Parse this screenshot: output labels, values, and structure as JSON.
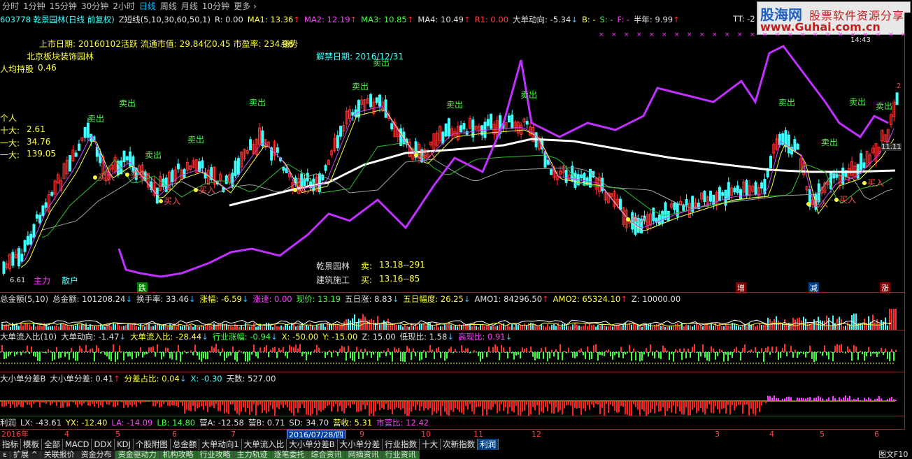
{
  "period_bar": [
    "分时",
    "1分钟",
    "15分钟",
    "30分钟",
    "2小时",
    "日线",
    "周线",
    "月线",
    "10分钟",
    "更多 ›"
  ],
  "period_active": "日线",
  "main_title": {
    "code_name": "603778 乾景园林(日线 前复权)",
    "formula": "Z短线(5,10,30,60,50,1)",
    "r": "R: 0.00",
    "ma1": "MA1: 13.36",
    "ma2": "MA2: 12.19",
    "ma3": "MA3: 10.85",
    "ma4": "MA4: 10.49",
    "r1": "R1: 0.00",
    "big_dir": "大单动向: -5.34",
    "b": "B: -",
    "s": "S: -",
    "f": "F: -",
    "half_year": "半年: 9.99",
    "tt": "TT: -2"
  },
  "overlay": {
    "list_date": "上市日期: 20160102活跃 流通市值: 29.84亿0.45 市盈率: 234.96",
    "strong": "强势",
    "sector": "北京板块装饰园林",
    "per_capita": "人均持股",
    "per_capita_val": "0.46",
    "unlock": "解禁日期: 2016/12/31",
    "individual": "个人",
    "top10_label": "十大:",
    "top10_val": "2.61",
    "first_a_label": "一大:",
    "first_a_val": "34.76",
    "first_b_label": "一大:",
    "first_b_val": "139.05",
    "stock_name": "乾景园林",
    "industry": "建筑施工",
    "sell_label": "卖:",
    "sell_val": "13.18--291",
    "buy_label": "买:",
    "buy_val": "13.16--85",
    "retail": "散户",
    "main_force": "主力",
    "low_price": "6.61",
    "time_tag": "14:43",
    "price_tag": "11.11",
    "axis_9": "9.",
    "axis_2": "2",
    "drop": "跌",
    "inc": "增",
    "cut": "减",
    "rise": "涨"
  },
  "signals": {
    "sell": "卖出",
    "buy": "买入"
  },
  "vol_title": {
    "name": "总金额(5,10)",
    "total": "总金额: 101208.24",
    "turnover": "换手率: 33.46",
    "chg": "涨幅: -6.59",
    "speed": "涨速: 0.00",
    "price": "现价: 13.19",
    "five_up": "五日涨: 8.83",
    "five_amp": "五日幅度: 26.25",
    "amo1": "AMO1: 84296.50",
    "amo2": "AMO2: 65324.10",
    "z": "Z: 10000.00"
  },
  "flow_title": {
    "name": "大单流入比(10)",
    "dir": "大单动向: -1.47",
    "ratio": "大单流入比: -28.44",
    "ind": "行业涨幅: -0.94",
    "x": "X: -50.00",
    "y": "Y: -15.00",
    "z": "Z: 15.00",
    "low": "低现比: 1.58",
    "high": "高现比: 0.91"
  },
  "diff_title": {
    "name": "大小单分差B",
    "diff": "大小单分差: 0.41",
    "pct": "分差占比: 0.04",
    "x": "X: -0.30",
    "days": "天数: 527.00"
  },
  "profit_title": {
    "name": "利润",
    "lx": "LX: -43.61",
    "yx": "YX: -12.40",
    "la": "LA: -14.09",
    "lb": "LB: 14.80",
    "ya": "营A: -12.58",
    "yb": "营B: 0.71",
    "sd": "SD: 34.70",
    "rev": "营收: 5.31",
    "pb": "市营比: 12.42"
  },
  "date_axis": {
    "year": "2016年",
    "labels": [
      "4",
      "5",
      "6",
      "7",
      "9",
      "10",
      "11",
      "12",
      "3",
      "4",
      "5",
      "6"
    ],
    "cursor": "2016/07/28/四"
  },
  "tabs_row1": [
    "指标",
    "模板",
    "全部",
    "MACD",
    "DDX",
    "KDJ",
    "个股附图",
    "总金额",
    "大单动向1",
    "大单流入比",
    "大小单分差B",
    "大小单分差",
    "行业指数",
    "十大",
    "次新指数",
    "利润"
  ],
  "tabs_row1_active": "利润",
  "tabs_row2": [
    "ε",
    "扩展 ^",
    "关联报价",
    "资金分布",
    "资金驱动力",
    "机构攻略",
    "行业攻略",
    "主力轨迹",
    "逐笔委托",
    "综合资讯",
    "网摘资讯",
    "行业资讯"
  ],
  "status_right": "图文F10",
  "logo": {
    "t1": "股海网",
    "t2": "股票软件资源分享",
    "t3": "www.Guhai.com.cn"
  },
  "colors": {
    "up": "#ff3030",
    "down": "#40ffff",
    "ma_white": "#ffffff",
    "ma_magenta": "#d040ff",
    "ma_yellow": "#ffff40",
    "ma_green": "#40ff40",
    "ma_gray": "#a0a0a0",
    "sell_text": "#40ff40",
    "buy_text": "#ff5050"
  }
}
